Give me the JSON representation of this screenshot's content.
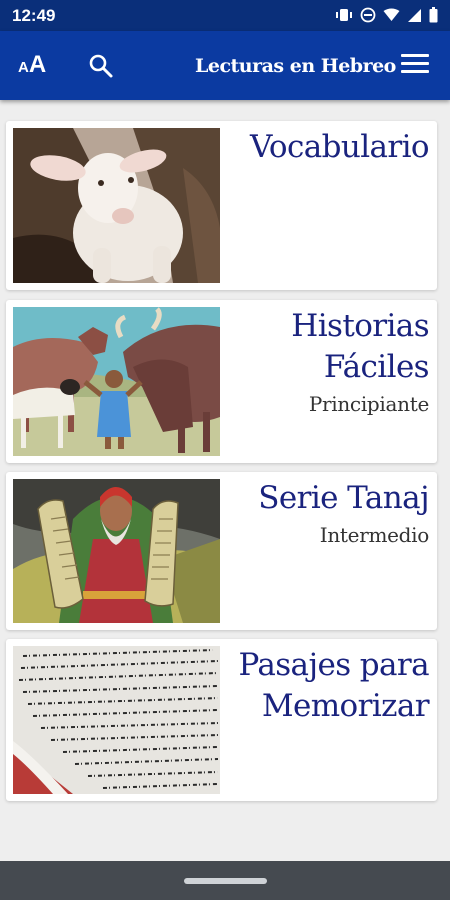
{
  "status_bar": {
    "time": "12:49",
    "icons": [
      "vibrate-icon",
      "do-not-disturb-icon",
      "wifi-icon",
      "signal-icon",
      "battery-icon"
    ]
  },
  "app_bar": {
    "font_size_label_small": "A",
    "font_size_label_big": "A",
    "title": "Lecturas en Hebreo",
    "background": "#0b3aa1"
  },
  "cards": [
    {
      "title_lines": [
        "Vocabulario"
      ],
      "subtitle": "",
      "image": "lamb-photo"
    },
    {
      "title_lines": [
        "Historias",
        "Fáciles"
      ],
      "subtitle": "Principiante",
      "image": "animals-boy-illustration"
    },
    {
      "title_lines": [
        "Serie Tanaj"
      ],
      "subtitle": "Intermedio",
      "image": "moses-tablets-illustration"
    },
    {
      "title_lines": [
        "Pasajes para",
        "Memorizar"
      ],
      "subtitle": "",
      "image": "hebrew-scroll-photo"
    }
  ],
  "colors": {
    "title_text": "#1a237e",
    "status_bar": "#0a2f7a"
  }
}
